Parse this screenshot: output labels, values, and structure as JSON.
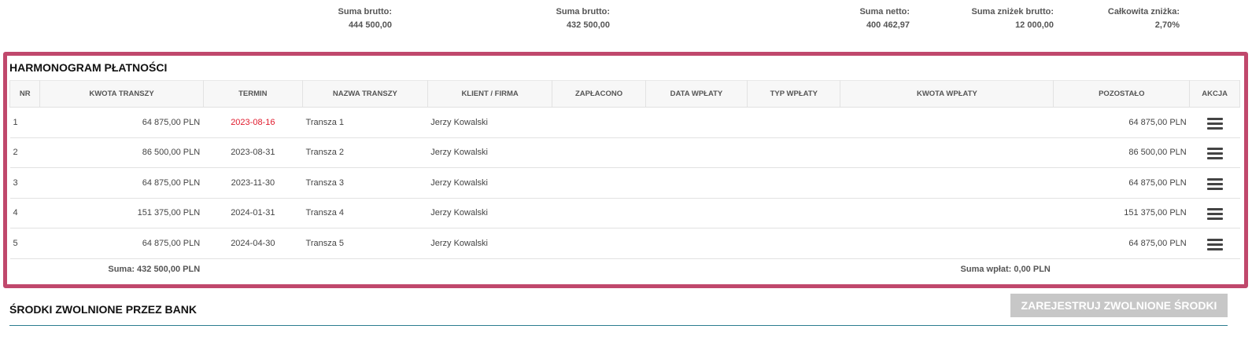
{
  "summary": [
    {
      "label": "Suma brutto:",
      "value": "444 500,00"
    },
    {
      "label": "Suma brutto:",
      "value": "432 500,00"
    },
    {
      "label": "Suma netto:",
      "value": "400 462,97"
    },
    {
      "label": "Suma zniżek brutto:",
      "value": "12 000,00"
    },
    {
      "label": "Całkowita zniżka:",
      "value": "2,70%"
    }
  ],
  "schedule": {
    "title": "HARMONOGRAM PŁATNOŚCI",
    "columns": [
      "NR",
      "KWOTA TRANSZY",
      "TERMIN",
      "NAZWA TRANSZY",
      "KLIENT / FIRMA",
      "ZAPŁACONO",
      "DATA WPŁATY",
      "TYP WPŁATY",
      "KWOTA WPŁATY",
      "POZOSTAŁO",
      "AKCJA"
    ],
    "rows": [
      {
        "nr": "1",
        "amount": "64 875,00 PLN",
        "due": "2023-08-16",
        "name": "Transza 1",
        "client": "Jerzy Kowalski",
        "paid": "",
        "pay_date": "",
        "pay_type": "",
        "pay_amount": "",
        "remaining": "64 875,00 PLN",
        "overdue": true
      },
      {
        "nr": "2",
        "amount": "86 500,00 PLN",
        "due": "2023-08-31",
        "name": "Transza 2",
        "client": "Jerzy Kowalski",
        "paid": "",
        "pay_date": "",
        "pay_type": "",
        "pay_amount": "",
        "remaining": "86 500,00 PLN",
        "overdue": false
      },
      {
        "nr": "3",
        "amount": "64 875,00 PLN",
        "due": "2023-11-30",
        "name": "Transza 3",
        "client": "Jerzy Kowalski",
        "paid": "",
        "pay_date": "",
        "pay_type": "",
        "pay_amount": "",
        "remaining": "64 875,00 PLN",
        "overdue": false
      },
      {
        "nr": "4",
        "amount": "151 375,00 PLN",
        "due": "2024-01-31",
        "name": "Transza 4",
        "client": "Jerzy Kowalski",
        "paid": "",
        "pay_date": "",
        "pay_type": "",
        "pay_amount": "",
        "remaining": "151 375,00 PLN",
        "overdue": false
      },
      {
        "nr": "5",
        "amount": "64 875,00 PLN",
        "due": "2024-04-30",
        "name": "Transza 5",
        "client": "Jerzy Kowalski",
        "paid": "",
        "pay_date": "",
        "pay_type": "",
        "pay_amount": "",
        "remaining": "64 875,00 PLN",
        "overdue": false
      }
    ],
    "footer": {
      "sum_amount": "Suma: 432 500,00 PLN",
      "sum_payments": "Suma wpłat: 0,00 PLN"
    },
    "overdue_color": "#e0192b",
    "border_color": "#c0486c",
    "action_icon": "hamburger-menu-icon"
  },
  "released_funds": {
    "title": "ŚRODKI ZWOLNIONE PRZEZ BANK",
    "register_button": "ZAREJESTRUJ ZWOLNIONE ŚRODKI",
    "line_color": "#2b7d8f"
  }
}
